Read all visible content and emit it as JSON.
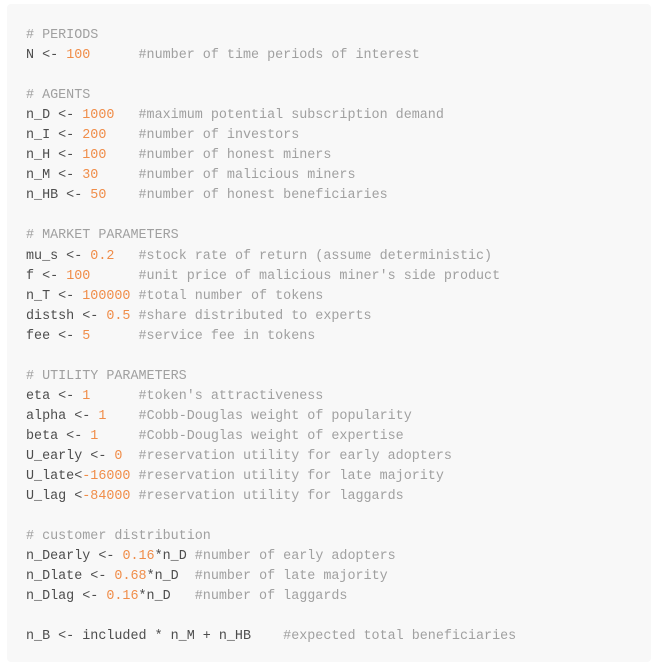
{
  "code": {
    "language": "r",
    "colors": {
      "background": "#f8f8f8",
      "text": "#4d4d4d",
      "comment": "#a0a0a0",
      "number": "#f08d49"
    },
    "lines": [
      [
        {
          "t": "c",
          "v": "# PERIODS"
        }
      ],
      [
        {
          "t": "t",
          "v": "N <- "
        },
        {
          "t": "n",
          "v": "100"
        },
        {
          "t": "t",
          "v": "      "
        },
        {
          "t": "c",
          "v": "#number of time periods of interest"
        }
      ],
      [],
      [
        {
          "t": "c",
          "v": "# AGENTS"
        }
      ],
      [
        {
          "t": "t",
          "v": "n_D <- "
        },
        {
          "t": "n",
          "v": "1000"
        },
        {
          "t": "t",
          "v": "   "
        },
        {
          "t": "c",
          "v": "#maximum potential subscription demand"
        }
      ],
      [
        {
          "t": "t",
          "v": "n_I <- "
        },
        {
          "t": "n",
          "v": "200"
        },
        {
          "t": "t",
          "v": "    "
        },
        {
          "t": "c",
          "v": "#number of investors"
        }
      ],
      [
        {
          "t": "t",
          "v": "n_H <- "
        },
        {
          "t": "n",
          "v": "100"
        },
        {
          "t": "t",
          "v": "    "
        },
        {
          "t": "c",
          "v": "#number of honest miners"
        }
      ],
      [
        {
          "t": "t",
          "v": "n_M <- "
        },
        {
          "t": "n",
          "v": "30"
        },
        {
          "t": "t",
          "v": "     "
        },
        {
          "t": "c",
          "v": "#number of malicious miners"
        }
      ],
      [
        {
          "t": "t",
          "v": "n_HB <- "
        },
        {
          "t": "n",
          "v": "50"
        },
        {
          "t": "t",
          "v": "    "
        },
        {
          "t": "c",
          "v": "#number of honest beneficiaries"
        }
      ],
      [],
      [
        {
          "t": "c",
          "v": "# MARKET PARAMETERS"
        }
      ],
      [
        {
          "t": "t",
          "v": "mu_s <- "
        },
        {
          "t": "n",
          "v": "0.2"
        },
        {
          "t": "t",
          "v": "   "
        },
        {
          "t": "c",
          "v": "#stock rate of return (assume deterministic)"
        }
      ],
      [
        {
          "t": "t",
          "v": "f <- "
        },
        {
          "t": "n",
          "v": "100"
        },
        {
          "t": "t",
          "v": "      "
        },
        {
          "t": "c",
          "v": "#unit price of malicious miner's side product"
        }
      ],
      [
        {
          "t": "t",
          "v": "n_T <- "
        },
        {
          "t": "n",
          "v": "100000"
        },
        {
          "t": "t",
          "v": " "
        },
        {
          "t": "c",
          "v": "#total number of tokens"
        }
      ],
      [
        {
          "t": "t",
          "v": "distsh <- "
        },
        {
          "t": "n",
          "v": "0.5"
        },
        {
          "t": "t",
          "v": " "
        },
        {
          "t": "c",
          "v": "#share distributed to experts"
        }
      ],
      [
        {
          "t": "t",
          "v": "fee <- "
        },
        {
          "t": "n",
          "v": "5"
        },
        {
          "t": "t",
          "v": "      "
        },
        {
          "t": "c",
          "v": "#service fee in tokens"
        }
      ],
      [],
      [
        {
          "t": "c",
          "v": "# UTILITY PARAMETERS"
        }
      ],
      [
        {
          "t": "t",
          "v": "eta <- "
        },
        {
          "t": "n",
          "v": "1"
        },
        {
          "t": "t",
          "v": "      "
        },
        {
          "t": "c",
          "v": "#token's attractiveness"
        }
      ],
      [
        {
          "t": "t",
          "v": "alpha <- "
        },
        {
          "t": "n",
          "v": "1"
        },
        {
          "t": "t",
          "v": "    "
        },
        {
          "t": "c",
          "v": "#Cobb-Douglas weight of popularity"
        }
      ],
      [
        {
          "t": "t",
          "v": "beta <- "
        },
        {
          "t": "n",
          "v": "1"
        },
        {
          "t": "t",
          "v": "     "
        },
        {
          "t": "c",
          "v": "#Cobb-Douglas weight of expertise"
        }
      ],
      [
        {
          "t": "t",
          "v": "U_early <- "
        },
        {
          "t": "n",
          "v": "0"
        },
        {
          "t": "t",
          "v": "  "
        },
        {
          "t": "c",
          "v": "#reservation utility for early adopters"
        }
      ],
      [
        {
          "t": "t",
          "v": "U_late<"
        },
        {
          "t": "n",
          "v": "-16000"
        },
        {
          "t": "t",
          "v": " "
        },
        {
          "t": "c",
          "v": "#reservation utility for late majority"
        }
      ],
      [
        {
          "t": "t",
          "v": "U_lag <"
        },
        {
          "t": "n",
          "v": "-84000"
        },
        {
          "t": "t",
          "v": " "
        },
        {
          "t": "c",
          "v": "#reservation utility for laggards"
        }
      ],
      [],
      [
        {
          "t": "c",
          "v": "# customer distribution"
        }
      ],
      [
        {
          "t": "t",
          "v": "n_Dearly <- "
        },
        {
          "t": "n",
          "v": "0.16"
        },
        {
          "t": "t",
          "v": "*n_D "
        },
        {
          "t": "c",
          "v": "#number of early adopters"
        }
      ],
      [
        {
          "t": "t",
          "v": "n_Dlate <- "
        },
        {
          "t": "n",
          "v": "0.68"
        },
        {
          "t": "t",
          "v": "*n_D  "
        },
        {
          "t": "c",
          "v": "#number of late majority"
        }
      ],
      [
        {
          "t": "t",
          "v": "n_Dlag <- "
        },
        {
          "t": "n",
          "v": "0.16"
        },
        {
          "t": "t",
          "v": "*n_D   "
        },
        {
          "t": "c",
          "v": "#number of laggards"
        }
      ],
      [],
      [
        {
          "t": "t",
          "v": "n_B <- included * n_M + n_HB    "
        },
        {
          "t": "c",
          "v": "#expected total beneficiaries"
        }
      ]
    ]
  }
}
